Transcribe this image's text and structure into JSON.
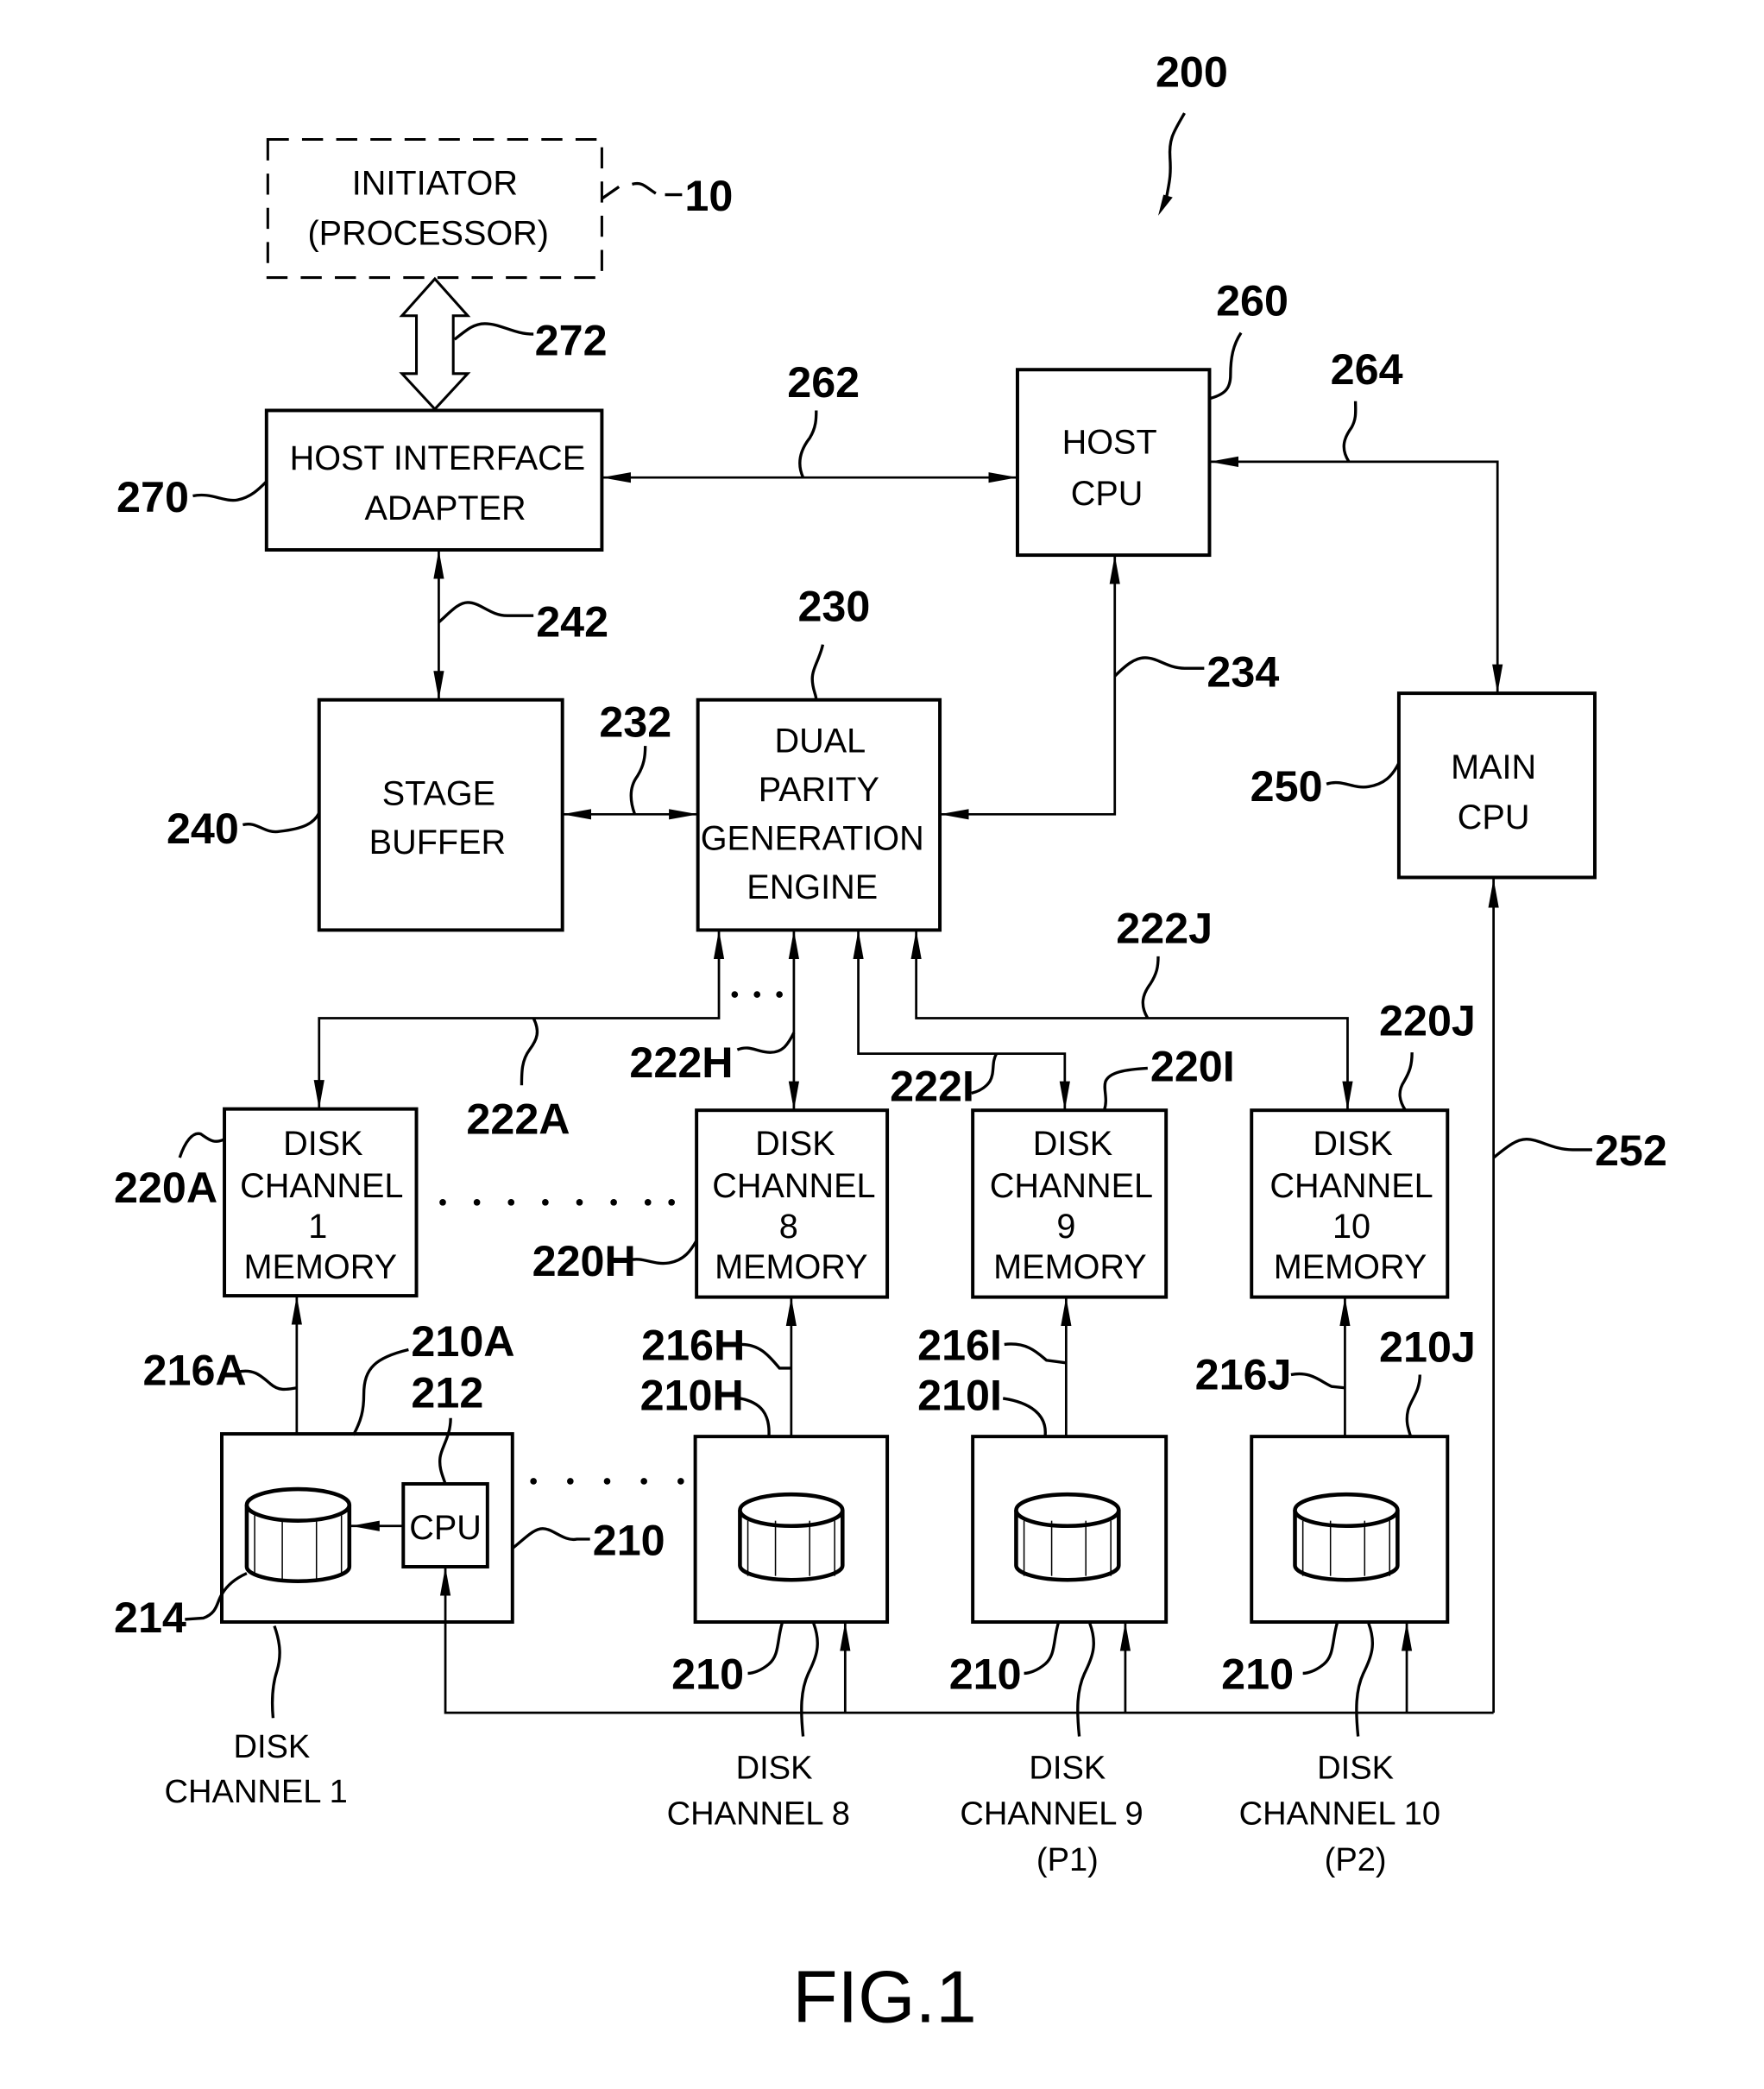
{
  "figure": {
    "caption": "FIG.1",
    "system_ref": "200"
  },
  "blocks": {
    "initiator": {
      "lines": [
        "INITIATOR",
        "(PROCESSOR)"
      ],
      "ref": "10"
    },
    "host_interface_adapter": {
      "lines": [
        "HOST  INTERFACE",
        "ADAPTER"
      ],
      "ref": "270"
    },
    "host_cpu": {
      "lines": [
        "HOST",
        "CPU"
      ],
      "ref": "260"
    },
    "stage_buffer": {
      "lines": [
        "STAGE",
        "BUFFER"
      ],
      "ref": "240"
    },
    "dual_parity_engine": {
      "lines": [
        "DUAL",
        "PARITY",
        "GENERATION",
        "ENGINE"
      ],
      "ref": "230"
    },
    "main_cpu": {
      "lines": [
        "MAIN",
        "CPU"
      ],
      "ref": "250"
    },
    "dcm1": {
      "lines": [
        "DISK",
        "CHANNEL",
        "1",
        "MEMORY"
      ],
      "ref": "220A"
    },
    "dcm8": {
      "lines": [
        "DISK",
        "CHANNEL",
        "8",
        "MEMORY"
      ],
      "ref": "220H"
    },
    "dcm9": {
      "lines": [
        "DISK",
        "CHANNEL",
        "9",
        "MEMORY"
      ],
      "ref": "220I"
    },
    "dcm10": {
      "lines": [
        "DISK",
        "CHANNEL",
        "10",
        "MEMORY"
      ],
      "ref": "220J"
    },
    "disk_cpu": {
      "label": "CPU",
      "ref": "212"
    }
  },
  "connections": {
    "c272": "272",
    "c262": "262",
    "c264": "264",
    "c242": "242",
    "c232": "232",
    "c234": "234",
    "c252": "252",
    "c222A": "222A",
    "c222H": "222H",
    "c222I": "222I",
    "c222J": "222J",
    "c216A": "216A",
    "c216H": "216H",
    "c216I": "216I",
    "c216J": "216J"
  },
  "disk_refs": {
    "r210A": "210A",
    "r210H": "210H",
    "r210I": "210I",
    "r210J": "210J",
    "r210": "210",
    "r214": "214"
  },
  "channels": [
    {
      "lines": [
        "DISK",
        "CHANNEL  1"
      ]
    },
    {
      "lines": [
        "DISK",
        "CHANNEL  8"
      ]
    },
    {
      "lines": [
        "DISK",
        "CHANNEL  9",
        "(P1)"
      ]
    },
    {
      "lines": [
        "DISK",
        "CHANNEL  10",
        "(P2)"
      ]
    }
  ]
}
